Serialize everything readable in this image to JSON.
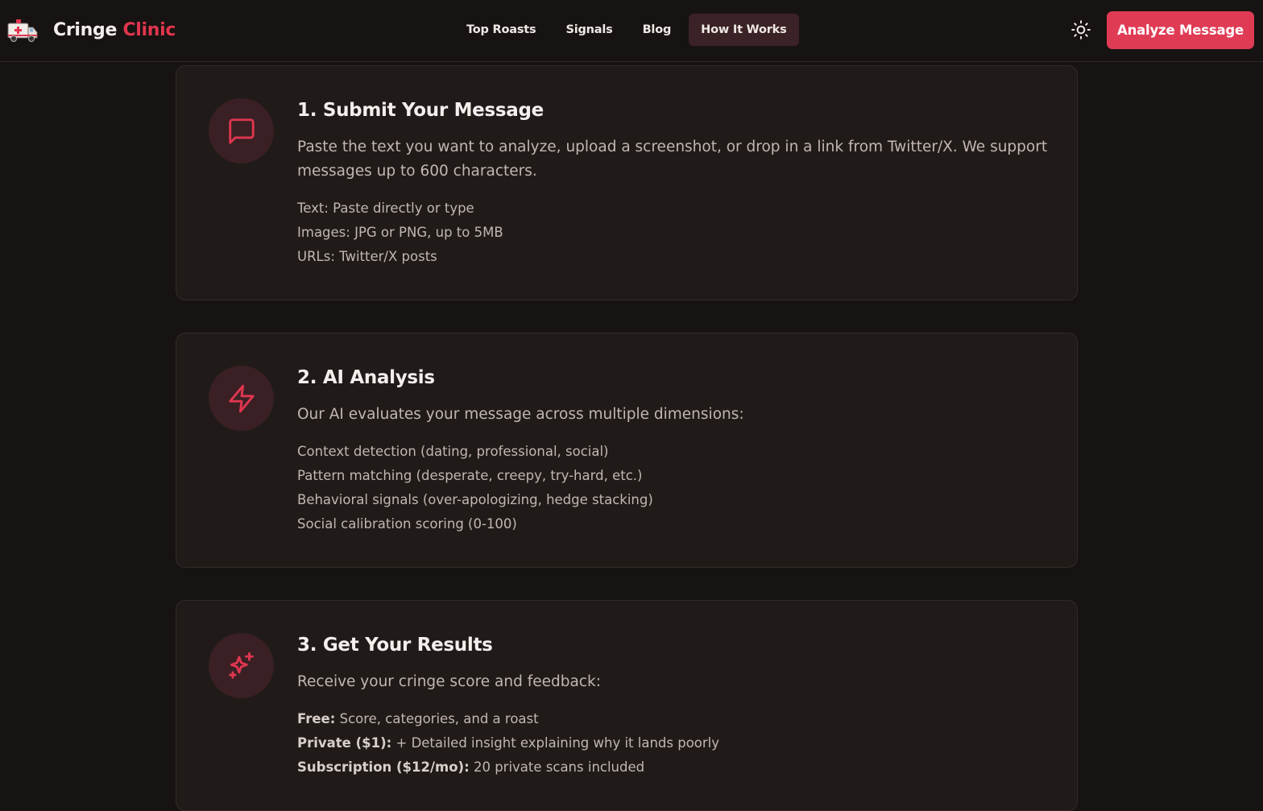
{
  "header": {
    "brand_part1": "Cringe",
    "brand_part2": "Clinic",
    "logo_icon": "ambulance-icon",
    "nav": [
      {
        "label": "Top Roasts",
        "active": false
      },
      {
        "label": "Signals",
        "active": false
      },
      {
        "label": "Blog",
        "active": false
      },
      {
        "label": "How It Works",
        "active": true
      }
    ],
    "theme_icon": "sun-icon",
    "cta_label": "Analyze Message"
  },
  "colors": {
    "background": "#171312",
    "card": "#201b19",
    "accent": "#e03b55",
    "icon_bg": "#3a2024"
  },
  "steps": [
    {
      "title": "1. Submit Your Message",
      "icon": "message-square-icon",
      "description": "Paste the text you want to analyze, upload a screenshot, or drop in a link from Twitter/X. We support messages up to 600 characters.",
      "items": [
        {
          "text": "Text: Paste directly or type"
        },
        {
          "text": "Images: JPG or PNG, up to 5MB"
        },
        {
          "text": "URLs: Twitter/X posts"
        }
      ]
    },
    {
      "title": "2. AI Analysis",
      "icon": "lightning-bolt-icon",
      "description": "Our AI evaluates your message across multiple dimensions:",
      "items": [
        {
          "text": "Context detection (dating, professional, social)"
        },
        {
          "text": "Pattern matching (desperate, creepy, try-hard, etc.)"
        },
        {
          "text": "Behavioral signals (over-apologizing, hedge stacking)"
        },
        {
          "text": "Social calibration scoring (0-100)"
        }
      ]
    },
    {
      "title": "3. Get Your Results",
      "icon": "sparkles-icon",
      "description": "Receive your cringe score and feedback:",
      "items": [
        {
          "label": "Free:",
          "text": "Score, categories, and a roast"
        },
        {
          "label": "Private ($1):",
          "text": "+ Detailed insight explaining why it lands poorly"
        },
        {
          "label": "Subscription ($12/mo):",
          "text": "20 private scans included"
        }
      ]
    }
  ]
}
